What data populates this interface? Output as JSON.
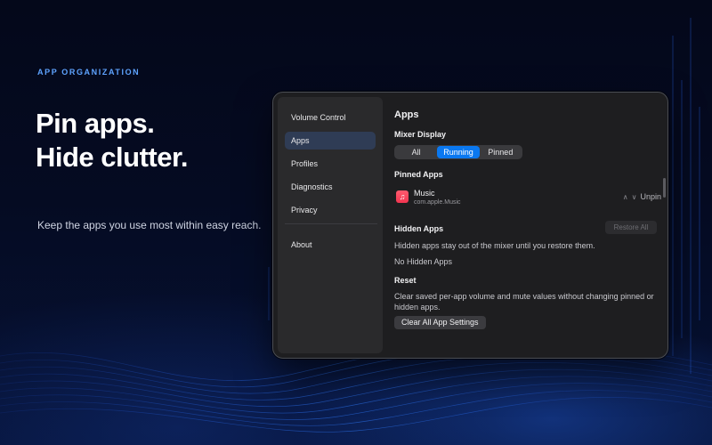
{
  "hero": {
    "eyebrow": "APP ORGANIZATION",
    "headline_line1": "Pin apps.",
    "headline_line2": "Hide clutter.",
    "tagline": "Keep the apps you use most within easy reach."
  },
  "sidebar": {
    "items": [
      {
        "label": "Volume Control",
        "active": false
      },
      {
        "label": "Apps",
        "active": true
      },
      {
        "label": "Profiles",
        "active": false
      },
      {
        "label": "Diagnostics",
        "active": false
      },
      {
        "label": "Privacy",
        "active": false
      }
    ],
    "about_label": "About"
  },
  "main": {
    "title": "Apps",
    "mixer_display": {
      "heading": "Mixer Display",
      "options": [
        "All",
        "Running",
        "Pinned"
      ],
      "selected": "Running"
    },
    "pinned_apps": {
      "heading": "Pinned Apps",
      "items": [
        {
          "name": "Music",
          "bundle_id": "com.apple.Music",
          "icon": "music-note-icon",
          "action_label": "Unpin"
        }
      ]
    },
    "hidden_apps": {
      "heading": "Hidden Apps",
      "restore_all_label": "Restore All",
      "description": "Hidden apps stay out of the mixer until you restore them.",
      "empty_label": "No Hidden Apps"
    },
    "reset": {
      "heading": "Reset",
      "description": "Clear saved per-app volume and mute values without changing pinned or hidden apps.",
      "button_label": "Clear All App Settings"
    }
  },
  "colors": {
    "accent": "#0a78f0",
    "eyebrow": "#5ea3ff",
    "music_icon": "#f23550"
  }
}
